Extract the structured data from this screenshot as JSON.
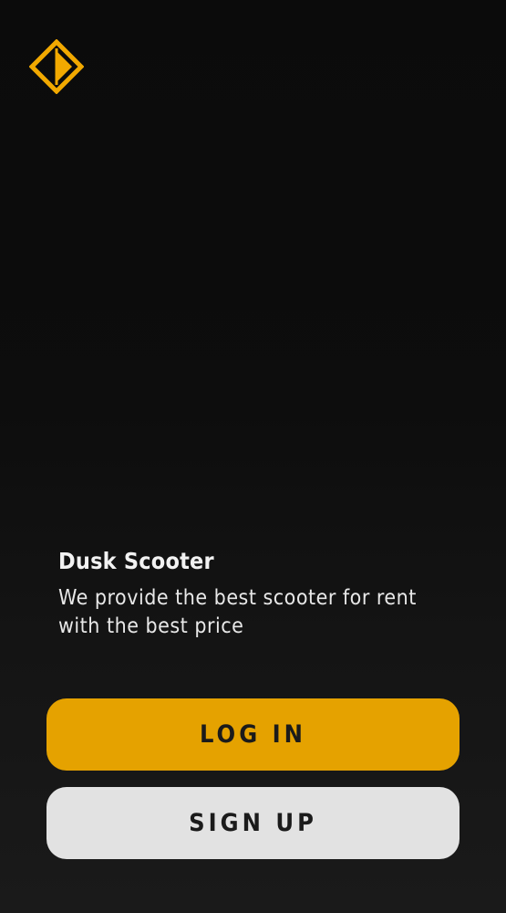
{
  "logo": {
    "icon": "diamond-logo-icon",
    "color": "#f2a900"
  },
  "intro": {
    "title": "Dusk Scooter",
    "tagline": "We provide the best scooter for rent with the best price"
  },
  "actions": {
    "login_label": "LOG IN",
    "signup_label": "SIGN UP"
  },
  "colors": {
    "primary": "#e5a200",
    "secondary": "#e2e2e2",
    "background": "#0b0b0b",
    "button_text": "#1b1b1b"
  }
}
